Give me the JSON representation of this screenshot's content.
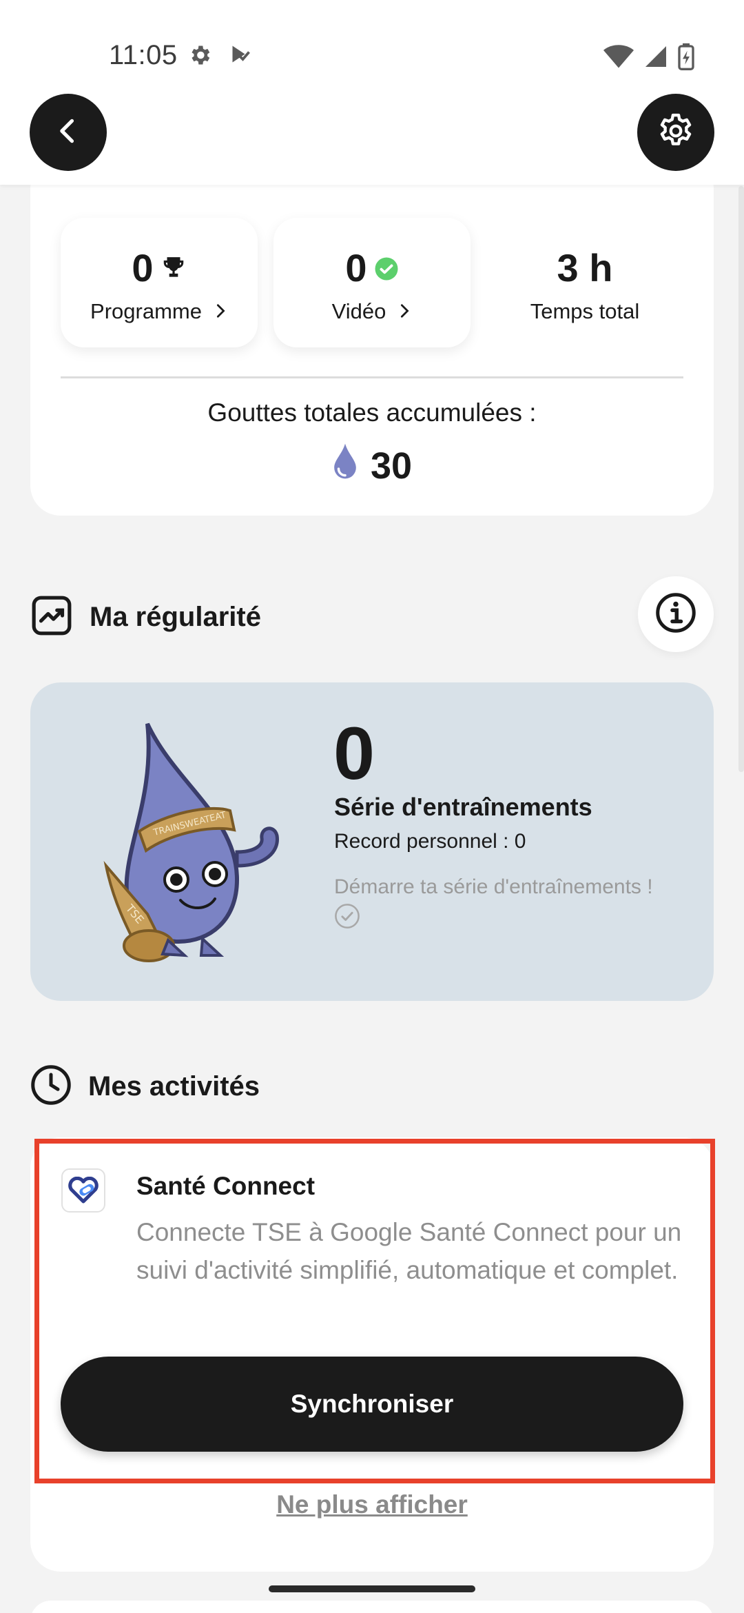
{
  "status_bar": {
    "time": "11:05",
    "left_icons": [
      "settings-icon",
      "play-protect-icon"
    ],
    "right_icons": [
      "wifi-icon",
      "signal-icon",
      "battery-charging-icon"
    ]
  },
  "header": {
    "back_icon": "chevron-left-icon",
    "settings_icon": "gear-icon"
  },
  "stats": {
    "programme": {
      "value": "0",
      "label": "Programme",
      "icon": "trophy-icon"
    },
    "video": {
      "value": "0",
      "label": "Vidéo",
      "icon": "check-circle-icon"
    },
    "time": {
      "value": "3 h",
      "label": "Temps total"
    },
    "total_label": "Gouttes totales accumulées :",
    "total_value": "30"
  },
  "regularity": {
    "title": "Ma régularité",
    "streak_value": "0",
    "streak_title": "Série d'entraînements",
    "record": "Record personnel : 0",
    "hint": "Démarre ta série d'entraînements !",
    "mascot_text_band": "TRAINSWEATEAT",
    "mascot_text_scroll": "TSE"
  },
  "activities": {
    "title": "Mes activités",
    "card_title": "Santé Connect",
    "card_desc": "Connecte TSE à Google Santé Connect pour un suivi d'activité simplifié, automatique et complet.",
    "sync_label": "Synchroniser",
    "hide_label": "Ne plus afficher"
  },
  "colors": {
    "accent_dark": "#1b1b1b",
    "highlight": "#e8412b",
    "streak_bg": "#d8e1e8",
    "drop": "#7b83c4",
    "success": "#5ccf6c"
  }
}
